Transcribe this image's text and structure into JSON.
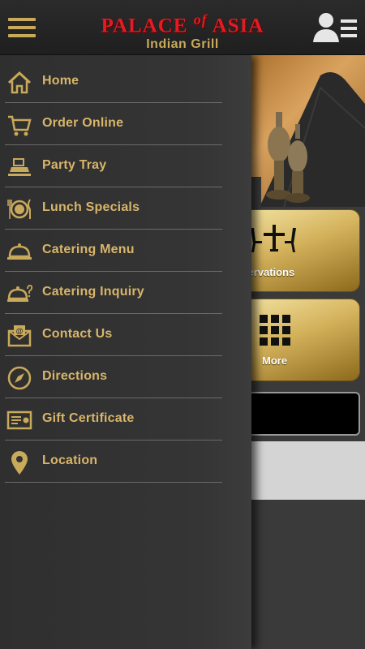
{
  "header": {
    "menu_icon": "hamburger-icon",
    "logo_main": "PALACE",
    "logo_of": "of",
    "logo_asia": "ASIA",
    "logo_sub": "Indian Grill",
    "account_icon": "user-list-icon",
    "colors": {
      "logo_red": "#e31b23",
      "gold": "#c9a95a"
    }
  },
  "drawer": {
    "items": [
      {
        "label": "Home",
        "icon": "home-icon"
      },
      {
        "label": "Order Online",
        "icon": "cart-icon"
      },
      {
        "label": "Party Tray",
        "icon": "tray-icon"
      },
      {
        "label": "Lunch Specials",
        "icon": "plate-cutlery-icon"
      },
      {
        "label": "Catering Menu",
        "icon": "cloche-icon"
      },
      {
        "label": "Catering Inquiry",
        "icon": "cloche-question-icon"
      },
      {
        "label": "Contact Us",
        "icon": "envelope-icon"
      },
      {
        "label": "Directions",
        "icon": "compass-icon"
      },
      {
        "label": "Gift Certificate",
        "icon": "certificate-icon"
      },
      {
        "label": "Location",
        "icon": "map-pin-icon"
      }
    ],
    "colors": {
      "label": "#d8b56a",
      "divider": "#6a6a6a"
    }
  },
  "main": {
    "tiles": [
      {
        "label": "eservations",
        "icon": "table-chairs-icon"
      },
      {
        "label": "More",
        "icon": "grid-icon"
      }
    ]
  }
}
